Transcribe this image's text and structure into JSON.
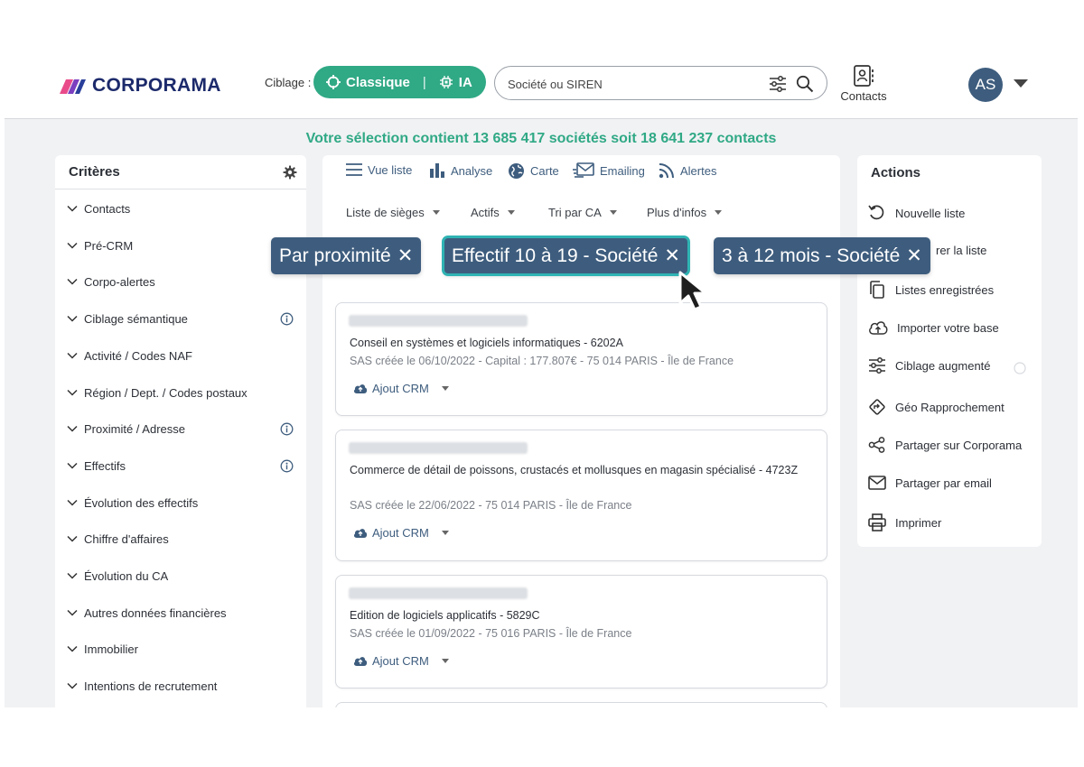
{
  "brand": {
    "name": "CORPORAMA"
  },
  "header": {
    "ciblage_label": "Ciblage :",
    "mode_classique": "Classique",
    "mode_separator": "|",
    "mode_ia": "IA",
    "search_placeholder": "Société ou SIREN",
    "contacts_label": "Contacts",
    "avatar_initials": "AS"
  },
  "summary": "Votre sélection contient 13 685 417 sociétés soit 18 641 237 contacts",
  "criteria": {
    "title": "Critères",
    "items": [
      {
        "label": "Contacts",
        "info": false
      },
      {
        "label": "Pré-CRM",
        "info": false
      },
      {
        "label": "Corpo-alertes",
        "info": false
      },
      {
        "label": "Ciblage sémantique",
        "info": true
      },
      {
        "label": "Activité / Codes NAF",
        "info": false
      },
      {
        "label": "Région / Dept. / Codes postaux",
        "info": false
      },
      {
        "label": "Proximité / Adresse",
        "info": true
      },
      {
        "label": "Effectifs",
        "info": true
      },
      {
        "label": "Évolution des effectifs",
        "info": false
      },
      {
        "label": "Chiffre d'affaires",
        "info": false
      },
      {
        "label": "Évolution du CA",
        "info": false
      },
      {
        "label": "Autres données financières",
        "info": false
      },
      {
        "label": "Immobilier",
        "info": false
      },
      {
        "label": "Intentions de recrutement",
        "info": false
      }
    ]
  },
  "tabs": [
    {
      "label": "Vue liste",
      "icon": "list-icon"
    },
    {
      "label": "Analyse",
      "icon": "bar-chart-icon"
    },
    {
      "label": "Carte",
      "icon": "globe-icon"
    },
    {
      "label": "Emailing",
      "icon": "mail-icon"
    },
    {
      "label": "Alertes",
      "icon": "rss-icon"
    }
  ],
  "dropdowns": [
    "Liste de sièges",
    "Actifs",
    "Tri par CA",
    "Plus d'infos"
  ],
  "filter_chips": [
    {
      "label": "Par proximité",
      "close": "✕",
      "active": false
    },
    {
      "label": "Effectif 10 à 19 - Société",
      "close": "✕",
      "active": true
    },
    {
      "label": "3 à 12 mois - Société",
      "close": "✕",
      "active": false
    }
  ],
  "companies": [
    {
      "title": "Conseil en systèmes et logiciels informatiques - 6202A",
      "meta": "SAS créée le 06/10/2022 - Capital : 177.807€ - 75 014 PARIS - Île de France",
      "crm": "Ajout CRM"
    },
    {
      "title": "Commerce de détail de poissons, crustacés et mollusques en magasin spécialisé - 4723Z",
      "meta": "SAS créée le 22/06/2022 - 75 014 PARIS - Île de France",
      "crm": "Ajout CRM"
    },
    {
      "title": "Edition de logiciels applicatifs - 5829C",
      "meta": "SAS créée le 01/09/2022 - 75 016 PARIS - Île de France",
      "crm": "Ajout CRM"
    }
  ],
  "actions": {
    "title": "Actions",
    "items": [
      {
        "label": "Nouvelle liste",
        "icon": "undo-icon"
      },
      {
        "label": "rer la liste",
        "icon": "save-icon"
      },
      {
        "label": "Listes enregistrées",
        "icon": "copy-icon"
      },
      {
        "label": "Importer votre base",
        "icon": "cloud-upload-icon"
      },
      {
        "label": "Ciblage augmenté",
        "icon": "sliders-icon"
      },
      {
        "label": "Géo Rapprochement",
        "icon": "direction-icon"
      },
      {
        "label": "Partager sur Corporama",
        "icon": "share-icon"
      },
      {
        "label": "Partager par email",
        "icon": "envelope-icon"
      },
      {
        "label": "Imprimer",
        "icon": "printer-icon"
      }
    ]
  },
  "colors": {
    "green": "#30a985",
    "navy": "#3e5d7e",
    "brand": "#1c2a6b",
    "chip_outline": "#2fb3b3"
  }
}
